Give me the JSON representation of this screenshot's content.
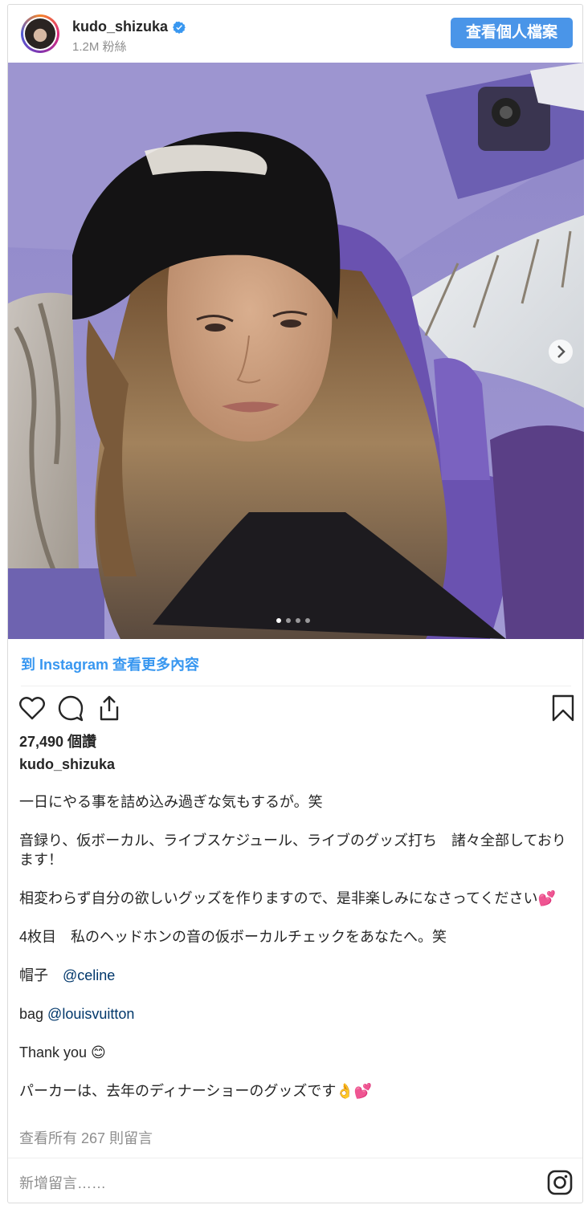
{
  "header": {
    "username": "kudo_shizuka",
    "followers": "1.2M 粉絲",
    "profile_button": "查看個人檔案"
  },
  "carousel": {
    "slide_count": 4,
    "active_slide": 1
  },
  "more_link": "到 Instagram 查看更多內容",
  "likes": "27,490 個讚",
  "caption": {
    "username": "kudo_shizuka",
    "line1": "一日にやる事を詰め込み過ぎな気もするが。笑",
    "line2": "音録り、仮ボーカル、ライブスケジュール、ライブのグッズ打ち　諸々全部しております！",
    "line3": "相変わらず自分の欲しいグッズを作りますので、是非楽しみになさってください💕",
    "line4": "4枚目　私のヘッドホンの音の仮ボーカルチェックをあなたへ。笑",
    "hat_label": "帽子　",
    "hat_mention": "@celine",
    "bag_label": "bag ",
    "bag_mention": "@louisvuitton",
    "thanks": "Thank you 😊",
    "hoodie": "パーカーは、去年のディナーショーのグッズです👌💕"
  },
  "view_comments": "查看所有 267 則留言",
  "add_comment_placeholder": "新增留言……",
  "colors": {
    "accent": "#3897f0",
    "button": "#4a95e8",
    "mention": "#00376b",
    "muted": "#8e8e8e"
  },
  "icons": [
    "verified-badge-icon",
    "heart-icon",
    "comment-icon",
    "share-icon",
    "bookmark-icon",
    "chevron-right-icon",
    "instagram-logo-icon"
  ]
}
